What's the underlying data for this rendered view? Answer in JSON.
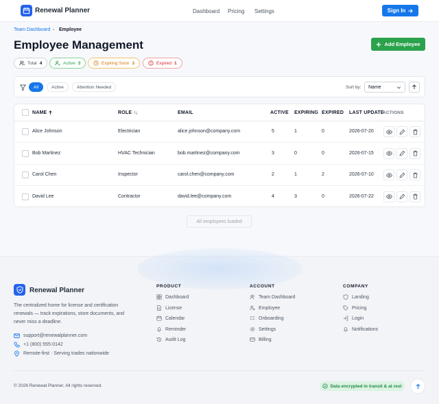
{
  "header": {
    "app_name": "Renewal Planner",
    "nav": [
      "Dashboard",
      "Pricing",
      "Settings"
    ],
    "sign_in": "Sign In"
  },
  "breadcrumb": {
    "parent": "Team Dashboard",
    "separator": "‹",
    "current": "Employee"
  },
  "page": {
    "title": "Employee Management",
    "add_button": "Add Employee"
  },
  "stats": [
    {
      "label": "Total",
      "count": "4",
      "icon": "users-icon",
      "color": "#4b5563"
    },
    {
      "label": "Active",
      "count": "3",
      "icon": "user-check-icon",
      "color": "#2ba24c"
    },
    {
      "label": "Expiring Soon",
      "count": "3",
      "icon": "clock-icon",
      "color": "#d97706"
    },
    {
      "label": "Expired",
      "count": "1",
      "icon": "alert-circle-icon",
      "color": "#dc2626"
    }
  ],
  "filters": {
    "tabs": [
      "All",
      "Active",
      "Attention Needed"
    ],
    "selected": "All",
    "sort_label": "Sort by:",
    "sort_value": "Name"
  },
  "table": {
    "columns": [
      "NAME",
      "ROLE",
      "EMAIL",
      "ACTIVE",
      "EXPIRING",
      "EXPIRED",
      "LAST UPDATE",
      "ACTIONS"
    ],
    "rows": [
      {
        "name": "Alice Johnson",
        "role": "Electrician",
        "email": "alice.johnson@company.com",
        "active": "5",
        "expiring": "1",
        "expired": "0",
        "last_update": "2026-07-20"
      },
      {
        "name": "Bob Martinez",
        "role": "HVAC Technician",
        "email": "bob.martinez@company.com",
        "active": "3",
        "expiring": "0",
        "expired": "0",
        "last_update": "2026-07-15"
      },
      {
        "name": "Carol Chen",
        "role": "Inspector",
        "email": "carol.chen@company.com",
        "active": "2",
        "expiring": "1",
        "expired": "2",
        "last_update": "2026-07-10"
      },
      {
        "name": "David Lee",
        "role": "Contractor",
        "email": "david.lee@company.com",
        "active": "4",
        "expiring": "3",
        "expired": "0",
        "last_update": "2026-07-22"
      }
    ],
    "footer_status": "All employees loaded"
  },
  "footer": {
    "brand": "Renewal Planner",
    "description": "The centralized home for license and certification renewals — track expirations, store documents, and never miss a deadline.",
    "email": "support@renewalplanner.com",
    "phone": "+1 (800) 555-0142",
    "location": "Remote-first · Serving trades nationwide",
    "columns": [
      {
        "title": "PRODUCT",
        "links": [
          "Dashboard",
          "License",
          "Calendar",
          "Reminder",
          "Audit Log"
        ]
      },
      {
        "title": "ACCOUNT",
        "links": [
          "Team Dashboard",
          "Employee",
          "Onboarding",
          "Settings",
          "Billing"
        ]
      },
      {
        "title": "COMPANY",
        "links": [
          "Landing",
          "Pricing",
          "Login",
          "Notifications"
        ]
      }
    ],
    "copyright": "© 2026 Renewal Planner. All rights reserved.",
    "encryption_badge": "Data encrypted in transit & at rest"
  },
  "colors": {
    "primary": "#1677ea",
    "success": "#2ba24c",
    "warning": "#d97706",
    "danger": "#dc2626"
  }
}
